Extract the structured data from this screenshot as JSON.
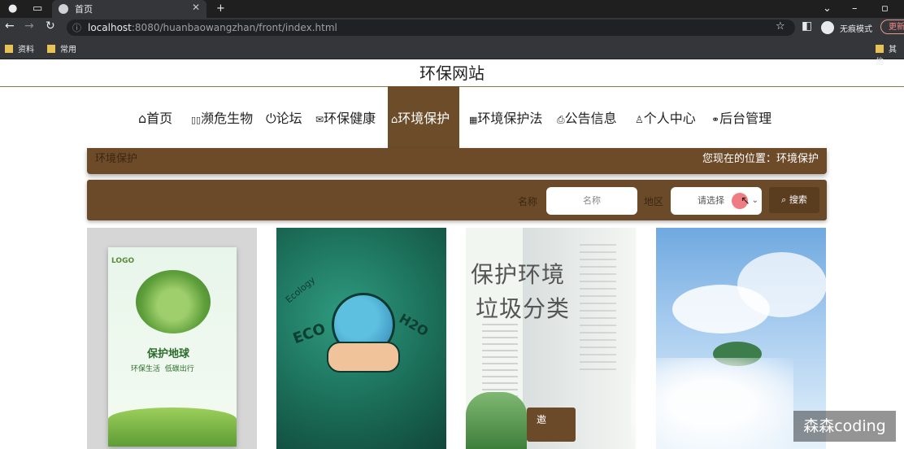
{
  "browser": {
    "tab_title": "首页",
    "url_host": "localhost",
    "url_rest": ":8080/huanbaowangzhan/front/index.html",
    "incognito_label": "无痕模式",
    "update_label": "更新",
    "bookmarks": [
      "资料",
      "常用"
    ],
    "bookmark_right": "其他"
  },
  "site": {
    "title": "环保网站",
    "nav": [
      {
        "icon": "home-icon",
        "label": "首页"
      },
      {
        "icon": "creature-icon",
        "label": "濒危生物"
      },
      {
        "icon": "power-icon",
        "label": "论坛"
      },
      {
        "icon": "mail-icon",
        "label": "环保健康"
      },
      {
        "icon": "tag-icon",
        "label": "环境保护"
      },
      {
        "icon": "grid-icon",
        "label": "环境保护法"
      },
      {
        "icon": "printer-icon",
        "label": "公告信息"
      },
      {
        "icon": "user-icon",
        "label": "个人中心"
      },
      {
        "icon": "link-icon",
        "label": "后台管理"
      }
    ],
    "active_nav": "环境保护"
  },
  "breadcrumb": {
    "left": "环境保护",
    "right": "您现在的位置：环境保护"
  },
  "search": {
    "name_label": "名称",
    "name_placeholder": "名称",
    "region_label": "地区",
    "region_value": "请选择",
    "button_label": "搜索"
  },
  "cards": {
    "card1": {
      "logo": "LOGO",
      "headline": "保护地球",
      "sub": "环保生活  低碳出行"
    },
    "card2": {
      "words": [
        "ECO",
        "Ecology",
        "H2O"
      ]
    },
    "card3": {
      "title_line1": "保护环境",
      "title_line2": "垃圾分类"
    },
    "card4": {}
  },
  "float_button": "邀",
  "watermark": "森森coding",
  "colors": {
    "accent": "#6d4c2a",
    "accent_dark": "#5a3c1f",
    "chrome": "#35363a"
  }
}
